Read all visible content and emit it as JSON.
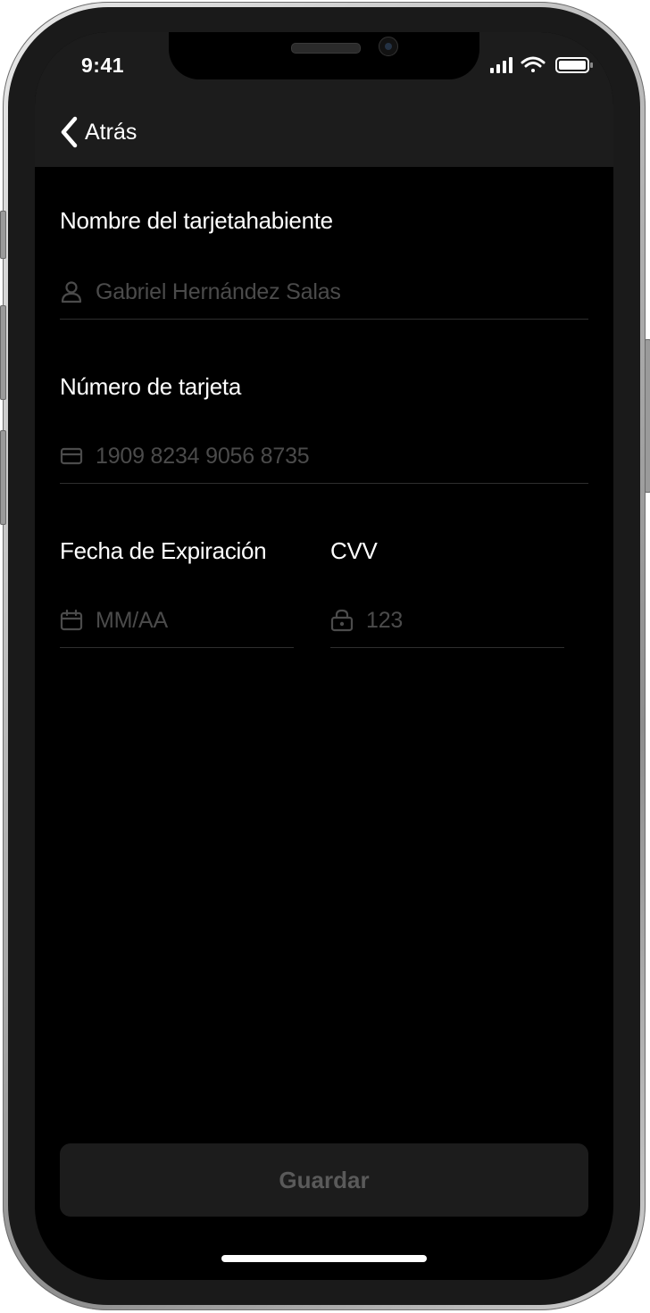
{
  "status_bar": {
    "time": "9:41",
    "icons": [
      "signal-icon",
      "wifi-icon",
      "battery-icon"
    ]
  },
  "nav": {
    "back_label": "Atrás",
    "back_icon": "chevron-left-icon"
  },
  "form": {
    "cardholder": {
      "label": "Nombre del tarjetahabiente",
      "placeholder": "Gabriel Hernández Salas",
      "icon": "user-icon"
    },
    "card_number": {
      "label": "Número de tarjeta",
      "placeholder": "1909 8234 9056 8735",
      "icon": "credit-card-icon"
    },
    "expiry": {
      "label": "Fecha de Expiración",
      "placeholder": "MM/AA",
      "icon": "calendar-icon"
    },
    "cvv": {
      "label": "CVV",
      "placeholder": "123",
      "icon": "lock-icon"
    }
  },
  "actions": {
    "save_label": "Guardar"
  },
  "colors": {
    "background": "#000000",
    "nav_background": "#1c1c1c",
    "label": "#ffffff",
    "placeholder": "#4b4b4b",
    "divider": "#2e2e2e",
    "button_background": "#1c1c1c",
    "button_text": "#5a5a5a"
  }
}
